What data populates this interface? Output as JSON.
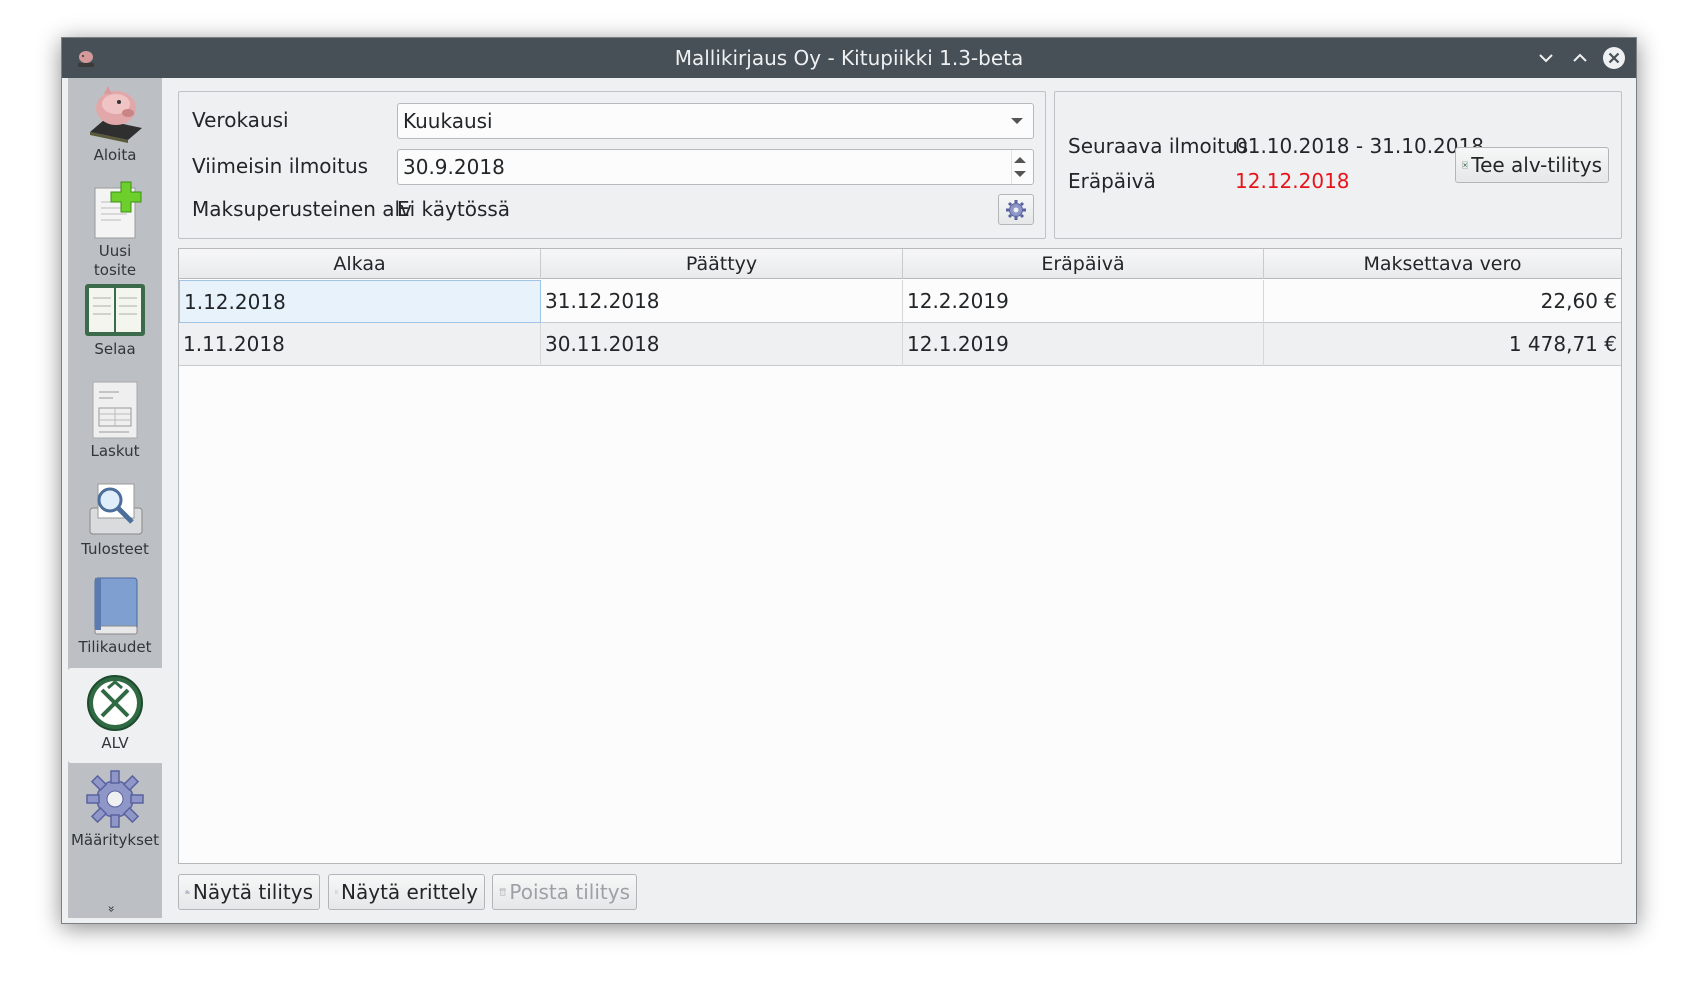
{
  "window": {
    "title": "Mallikirjaus Oy - Kitupiikki 1.3-beta",
    "icons": [
      "app-icon",
      "minimize-icon",
      "maximize-icon",
      "close-icon"
    ]
  },
  "sidebar": {
    "items": [
      {
        "label": "Aloita",
        "icon": "piggy-bank-icon"
      },
      {
        "label": "Uusi\ntosite",
        "icon": "new-document-icon"
      },
      {
        "label": "Selaa",
        "icon": "ledger-book-icon"
      },
      {
        "label": "Laskut",
        "icon": "invoice-icon"
      },
      {
        "label": "Tulosteet",
        "icon": "print-preview-icon"
      },
      {
        "label": "Tilikaudet",
        "icon": "book-icon"
      },
      {
        "label": "ALV",
        "icon": "tax-emblem-icon",
        "active": true
      },
      {
        "label": "Määritykset",
        "icon": "gear-icon"
      }
    ],
    "more": "»"
  },
  "settings": {
    "verokausi_label": "Verokausi",
    "verokausi_value": "Kuukausi",
    "viimeisin_label": "Viimeisin ilmoitus",
    "viimeisin_value": "30.9.2018",
    "maksu_label": "Maksuperusteinen alv",
    "maksu_value": "Ei käytössä"
  },
  "next": {
    "seuraava_label": "Seuraava ilmoitus",
    "seuraava_value": "01.10.2018 - 31.10.2018",
    "erapaiva_label": "Eräpäivä",
    "erapaiva_value": "12.12.2018",
    "erapaiva_color": "#e8141c",
    "button_label": "Tee alv-tilitys"
  },
  "table": {
    "headers": [
      "Alkaa",
      "Päättyy",
      "Eräpäivä",
      "Maksettava vero"
    ],
    "rows": [
      [
        "1.12.2018",
        "31.12.2018",
        "12.2.2019",
        "22,60 €"
      ],
      [
        "1.11.2018",
        "30.11.2018",
        "12.1.2019",
        "1 478,71 €"
      ]
    ]
  },
  "footer": {
    "nayta_tilitys": "Näytä tilitys",
    "nayta_erittely": "Näytä erittely",
    "poista_tilitys": "Poista tilitys"
  }
}
